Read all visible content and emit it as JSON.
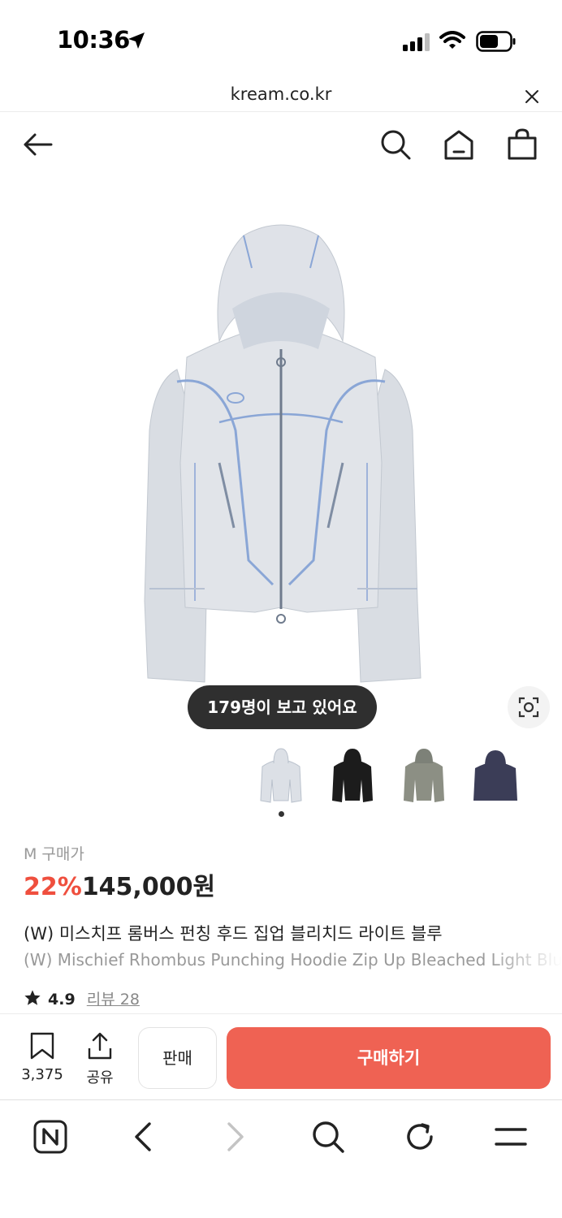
{
  "status_bar": {
    "time": "10:36"
  },
  "browser": {
    "url": "kream.co.kr"
  },
  "product": {
    "viewers_badge": "179명이 보고 있어요",
    "size_label": "M 구매가",
    "discount": "22%",
    "price": "145,000원",
    "title_ko": "(W) 미스치프 롬버스 펀칭 후드 집업 블리치드 라이트 블루",
    "title_en": "(W) Mischief Rhombus Punching Hoodie Zip Up Bleached Light Blue",
    "rating": "4.9",
    "reviews": "리뷰 28"
  },
  "actions": {
    "wishlist_count": "3,375",
    "share_label": "공유",
    "sell_label": "판매",
    "buy_label": "구매하기"
  },
  "colors": {
    "accent": "#ef4f3e",
    "buy_button": "#ef6253",
    "viewers_pill": "#2f2f2f"
  },
  "icons": [
    "back-arrow-icon",
    "search-icon",
    "home-icon",
    "shopping-bag-icon",
    "lens-icon",
    "bookmark-icon",
    "share-icon",
    "naver-icon",
    "chevron-left-icon",
    "chevron-right-icon",
    "reload-icon",
    "menu-icon",
    "close-icon",
    "star-icon"
  ]
}
